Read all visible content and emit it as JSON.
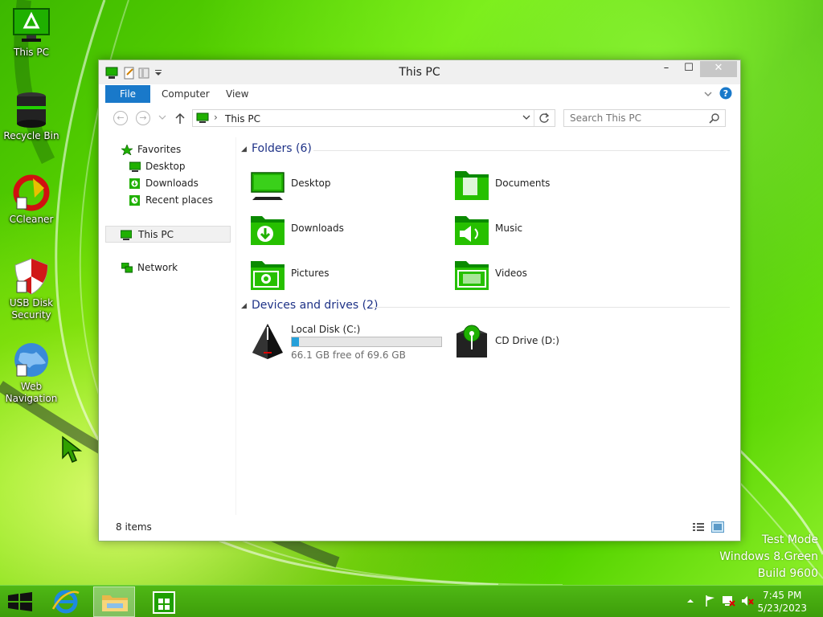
{
  "desktop": {
    "icons": [
      {
        "label": "This PC"
      },
      {
        "label": "Recycle Bin"
      },
      {
        "label": "CCleaner"
      },
      {
        "label": "USB Disk Security"
      },
      {
        "label": "Web Navigation"
      }
    ],
    "watermark": {
      "line1": "Test Mode",
      "line2": "Windows 8.Green",
      "line3": "Build 9600"
    }
  },
  "window": {
    "title": "This PC",
    "controls": {
      "minimize": "–",
      "maximize": "☐",
      "close": "✕"
    },
    "ribbon_tabs": [
      "File",
      "Computer",
      "View"
    ],
    "address": {
      "path": "This PC",
      "separator": "›"
    },
    "search": {
      "placeholder": "Search This PC"
    },
    "nav": {
      "favorites": "Favorites",
      "favorites_items": [
        "Desktop",
        "Downloads",
        "Recent places"
      ],
      "this_pc": "This PC",
      "network": "Network"
    },
    "groups": {
      "folders_header": "Folders (6)",
      "drives_header": "Devices and drives (2)"
    },
    "folders": [
      "Desktop",
      "Documents",
      "Downloads",
      "Music",
      "Pictures",
      "Videos"
    ],
    "drives": [
      {
        "name": "Local Disk (C:)",
        "free_text": "66.1 GB free of 69.6 GB",
        "used_fraction": 0.05
      },
      {
        "name": "CD Drive (D:)"
      }
    ],
    "status": "8 items"
  },
  "taskbar": {
    "time": "7:45 PM",
    "date": "5/23/2023"
  },
  "colors": {
    "accent": "#1979ca",
    "desktop_green": "#5fd000",
    "icon_green": "#1fb000",
    "drive_bar": "#26a0da"
  }
}
